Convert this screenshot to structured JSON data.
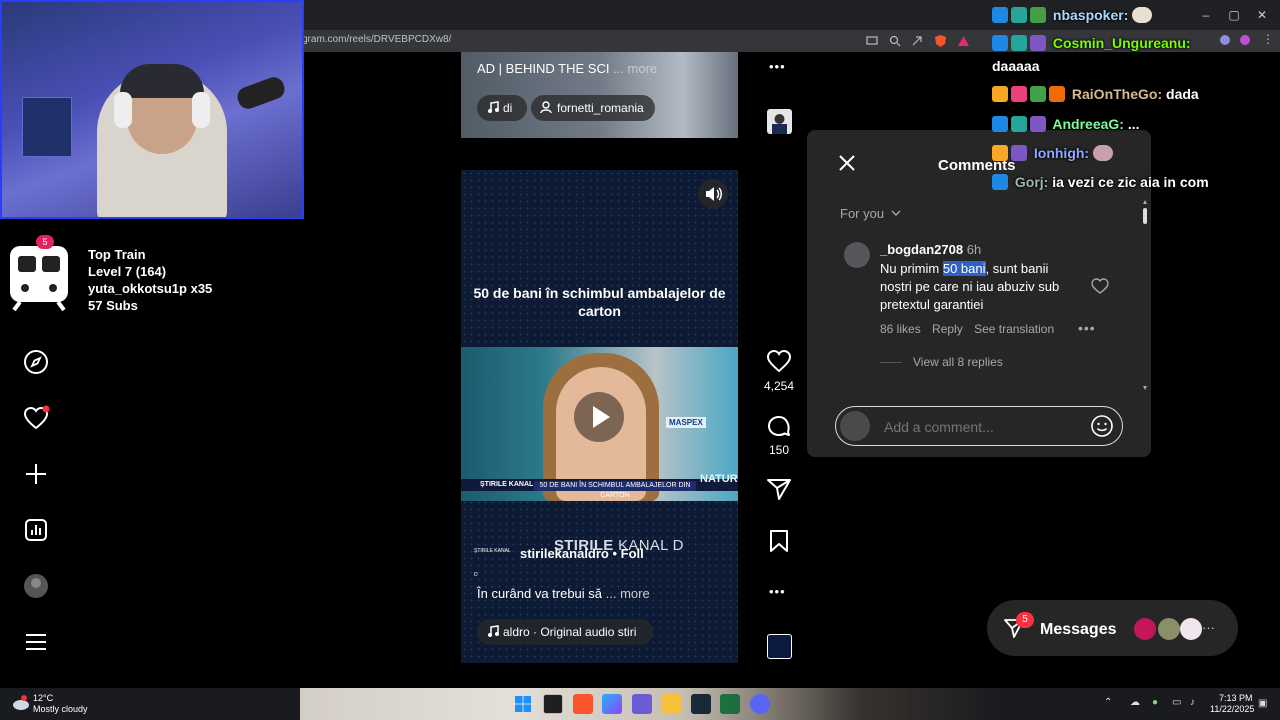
{
  "browser": {
    "url": "gram.com/reels/DRVEBPCDXw8/",
    "minimize": "–",
    "restore": "▢",
    "close": "✕"
  },
  "sidebar": {
    "notification_count": "5",
    "top_train": {
      "title": "Top Train",
      "level": "Level 7  (164)",
      "user": "yuta_okkotsu1p x35",
      "subs": "57 Subs"
    }
  },
  "reel_top": {
    "caption": "AD | BEHIND THE SCI",
    "more": "... more",
    "audio_chip": "di",
    "user_chip": "fornetti_romania"
  },
  "reel_main": {
    "headline": "50 de bani în schimbul ambalajelor de carton",
    "ticker_brand": "ȘTIRILE KANAL D",
    "ticker_text": "50 DE BANI ÎN SCHIMBUL AMBALAJELOR DIN CARTON",
    "maspex": "MASPEX",
    "side_text": "NATUR",
    "brand_overlay_bold": "ŞTIRILE",
    "brand_overlay_thin": "KANAL D",
    "account_avatar_text": "ŞTIRILE KANAL D",
    "account": "stirilekanaldro  •  Foll",
    "caption": "În curând va trebui să",
    "more": "... more",
    "audio": "aldro · Original audio  stiri"
  },
  "actions": {
    "likes": "4,254",
    "comments": "150",
    "more_top": "•••",
    "more_bottom": "•••"
  },
  "comments_panel": {
    "title": "Comments",
    "sort": "For you",
    "comment": {
      "user": "_bogdan2708",
      "time": "6h",
      "text_before": "Nu primim ",
      "text_highlight": "50 bani",
      "text_after": ", sunt banii noștri pe care ni iau abuziv sub pretextul garantiei",
      "likes": "86 likes",
      "reply": "Reply",
      "translate": "See translation",
      "more": "•••",
      "view_replies": "View all 8 replies"
    },
    "add_comment_placeholder": "Add a comment..."
  },
  "chat": [
    {
      "user": "nbaspoker:",
      "message": "",
      "color": "#a9d8ff"
    },
    {
      "user": "Cosmin_Ungureanu:",
      "message": "",
      "color": "#7cfc00"
    },
    {
      "user": "",
      "message": "daaaaa",
      "color": "#ffffff"
    },
    {
      "user": "RaiOnTheGo:",
      "message": "dada",
      "color": "#d7b98e"
    },
    {
      "user": "AndreeaG:",
      "message": "...",
      "color": "#7cfc9a"
    },
    {
      "user": "Ionhigh:",
      "message": "",
      "color": "#8fa8ff"
    },
    {
      "user": "Gorj:",
      "message": "ia vezi ce zic aia in com",
      "color": "#a0b8a8"
    }
  ],
  "messages": {
    "label": "Messages",
    "badge": "5",
    "more": "···"
  },
  "taskbar": {
    "weather_temp": "12°C",
    "weather_cond": "Mostly cloudy",
    "time": "7:13 PM",
    "date": "11/22/2025"
  },
  "colors": {
    "comment_panel_bg": "#262626",
    "highlight": "#2f62c9",
    "notification_red": "#ff3040"
  }
}
